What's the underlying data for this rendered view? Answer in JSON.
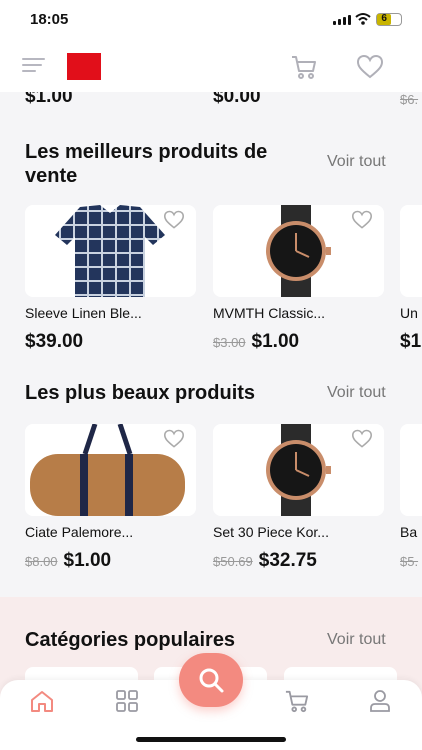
{
  "status_bar": {
    "time": "18:05",
    "battery": "6"
  },
  "colors": {
    "accent": "#f38a80",
    "brand_logo": "#e10f1a",
    "strike": "#999999"
  },
  "header": {
    "menu_icon": "hamburger-icon",
    "cart_icon": "cart-icon",
    "favorite_icon": "heart-icon"
  },
  "previous_section": {
    "prices": [
      "$1.00",
      "$0.00",
      "$6."
    ]
  },
  "best_sellers": {
    "title": "Les meilleurs produits de vente",
    "see_all": "Voir tout",
    "products": [
      {
        "name": "Sleeve Linen Ble...",
        "old_price": "",
        "price": "$39.00"
      },
      {
        "name": "MVMTH Classic...",
        "old_price": "$3.00",
        "price": "$1.00"
      },
      {
        "name": "Un",
        "old_price": "",
        "price": "$1"
      }
    ]
  },
  "most_beautiful": {
    "title": "Les plus beaux produits",
    "see_all": "Voir tout",
    "products": [
      {
        "name": "Ciate Palemore...",
        "old_price": "$8.00",
        "price": "$1.00"
      },
      {
        "name": "Set 30 Piece Kor...",
        "old_price": "$50.69",
        "price": "$32.75"
      },
      {
        "name": "Ba",
        "old_price": "$5.",
        "price": ""
      }
    ]
  },
  "categories": {
    "title": "Catégories populaires",
    "see_all": "Voir tout"
  },
  "tab_bar": {
    "tabs": [
      "home-icon",
      "grid-icon",
      "search-icon",
      "cart-icon",
      "user-icon"
    ]
  }
}
